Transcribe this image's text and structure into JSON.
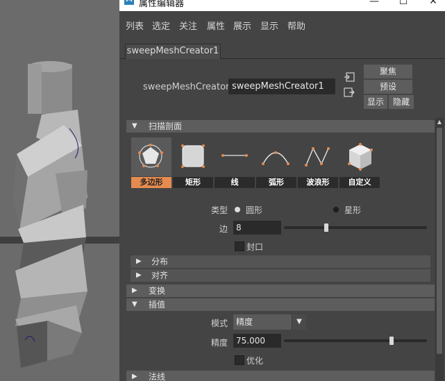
{
  "window": {
    "title": "属性编辑器",
    "app_icon": "M",
    "controls": {
      "minimize": "—",
      "maximize": "☐",
      "close": "✕"
    }
  },
  "menu": [
    "列表",
    "选定",
    "关注",
    "属性",
    "展示",
    "显示",
    "帮助"
  ],
  "tab": {
    "label": "sweepMeshCreator1"
  },
  "node": {
    "label": "sweepMeshCreator:",
    "value": "sweepMeshCreator1",
    "focus_button": "聚焦",
    "presets_button": "预设",
    "show_button": "显示",
    "hide_button": "隐藏"
  },
  "sections": {
    "scan_profile": "扫描剖面",
    "distribution": "分布",
    "alignment": "对齐",
    "transform": "变换",
    "interpolation": "插值",
    "normals": "法线"
  },
  "profiles": {
    "items": [
      {
        "label": "多边形",
        "icon": "polygon-icon",
        "active": true
      },
      {
        "label": "矩形",
        "icon": "rectangle-icon",
        "active": false
      },
      {
        "label": "线",
        "icon": "line-icon",
        "active": false
      },
      {
        "label": "弧形",
        "icon": "arc-icon",
        "active": false
      },
      {
        "label": "波浪形",
        "icon": "wave-icon",
        "active": false
      },
      {
        "label": "自定义",
        "icon": "custom-icon",
        "active": false
      }
    ],
    "active_color": "#e68b4f"
  },
  "polygon": {
    "type_label": "类型",
    "type_circle": "圆形",
    "type_star": "星形",
    "type_selected": "圆形",
    "sides_label": "边",
    "sides_value": "8",
    "sides_slider": {
      "min": 3,
      "max": 20,
      "value": 8
    },
    "cap_label": "封口",
    "cap_checked": false
  },
  "interpolation": {
    "mode_label": "模式",
    "mode_value": "精度",
    "precision_label": "精度",
    "precision_value": "75.000",
    "precision_slider": {
      "min": 0,
      "max": 100,
      "value": 75
    },
    "optimize_label": "优化",
    "optimize_checked": false
  }
}
